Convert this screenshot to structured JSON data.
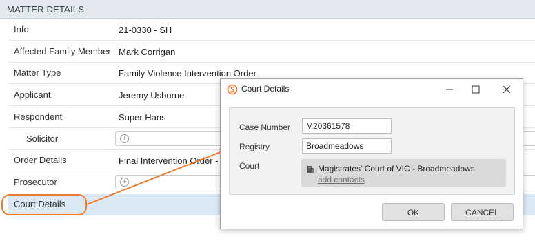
{
  "panel": {
    "title": "MATTER DETAILS",
    "rows": [
      {
        "label": "Info",
        "value": "21-0330 - SH"
      },
      {
        "label": "Affected Family Member",
        "value": "Mark Corrigan"
      },
      {
        "label": "Matter Type",
        "value": "Family Violence Intervention Order"
      },
      {
        "label": "Applicant",
        "value": "Jeremy Usborne"
      },
      {
        "label": "Respondent",
        "value": "Super Hans"
      },
      {
        "label": "Solicitor",
        "value": ""
      },
      {
        "label": "Order Details",
        "value": "Final Intervention Order -"
      },
      {
        "label": "Prosecutor",
        "value": ""
      },
      {
        "label": "Court Details",
        "value": ""
      }
    ]
  },
  "dialog": {
    "title": "Court Details",
    "case_number_label": "Case Number",
    "case_number_value": "M20361578",
    "registry_label": "Registry",
    "registry_value": "Broadmeadows",
    "court_label": "Court",
    "court_name": "Magistrates' Court of VIC - Broadmeadows",
    "add_contacts": "add contacts",
    "ok_label": "OK",
    "cancel_label": "CANCEL"
  },
  "icons": {
    "logo": "app-logo-icon",
    "minimize": "minimize-icon",
    "maximize": "maximize-icon",
    "close": "close-icon",
    "building": "building-icon",
    "add": "add-circle-icon"
  },
  "colors": {
    "accent": "#ee7a2e",
    "header_bg": "#e3e8ef",
    "selected_row": "#dbe9f6"
  }
}
